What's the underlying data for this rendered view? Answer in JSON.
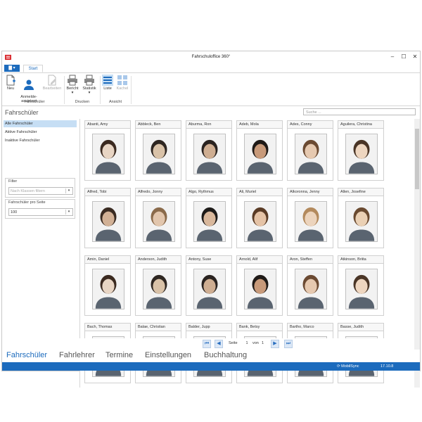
{
  "window": {
    "title": "Fahrschuloffice 360°"
  },
  "ribbon": {
    "file_button": "▾",
    "tab_start": "Start",
    "buttons": {
      "neu": "Neu",
      "anmelde": "Anmelde-\nassistent",
      "bearbeiten": "Bearbeiten",
      "bericht": "Bericht",
      "statistik": "Statistik",
      "liste": "Liste",
      "kachel": "Kachel"
    },
    "groups": {
      "fahrschueler": "Fahrschüler",
      "drucken": "Drucken",
      "ansicht": "Ansicht"
    }
  },
  "section_title": "Fahrschüler",
  "search": {
    "placeholder": "Suche ..."
  },
  "sidebar": {
    "items": [
      "Alle Fahrschüler",
      "Aktive Fahrschüler",
      "Inaktive Fahrschüler"
    ],
    "filter_label": "Filter",
    "filter_placeholder": "Nach Klassen filtern",
    "per_page_label": "Fahrschüler pro Seite",
    "per_page_value": "100"
  },
  "students": [
    {
      "name": "Abanti, Amy"
    },
    {
      "name": "Abbleck, Ben"
    },
    {
      "name": "Aburma, Ron"
    },
    {
      "name": "Adeb, Mola"
    },
    {
      "name": "Ades, Conny"
    },
    {
      "name": "Aguilera, Christina"
    },
    {
      "name": "Alfred, Tobi"
    },
    {
      "name": "Alfredo, Jonny"
    },
    {
      "name": "Algo, Rythmus"
    },
    {
      "name": "Ali, Muriel"
    },
    {
      "name": "Alkoronna, Jenny"
    },
    {
      "name": "Allen, Josefine"
    },
    {
      "name": "Amin, Daniel"
    },
    {
      "name": "Anderson, Judith"
    },
    {
      "name": "Antony, Suse"
    },
    {
      "name": "Arnold, Alif"
    },
    {
      "name": "Aron, Steffen"
    },
    {
      "name": "Atkinson, Briita"
    },
    {
      "name": "Bach, Thomas"
    },
    {
      "name": "Balae, Christian"
    },
    {
      "name": "Balder, Jupp"
    },
    {
      "name": "Bank, Betsy"
    },
    {
      "name": "Bartho, Marco"
    },
    {
      "name": "Basse, Judith"
    }
  ],
  "pager": {
    "page_label": "Seite",
    "page": "1",
    "of_label": "von",
    "total": "1"
  },
  "bottom_nav": [
    "Fahrschüler",
    "Fahrlehrer",
    "Termine",
    "Einstellungen",
    "Buchhaltung"
  ],
  "status": {
    "sync": "MobilSync",
    "version": "17.10.8"
  },
  "colors": {
    "accent": "#1c6bbd",
    "selection": "#c6def4"
  },
  "icons": [
    "app-icon",
    "new-icon",
    "assistant-icon",
    "edit-icon",
    "report-icon",
    "statistics-icon",
    "list-icon",
    "tiles-icon",
    "first-page-icon",
    "prev-page-icon",
    "next-page-icon",
    "last-page-icon",
    "sync-icon"
  ]
}
